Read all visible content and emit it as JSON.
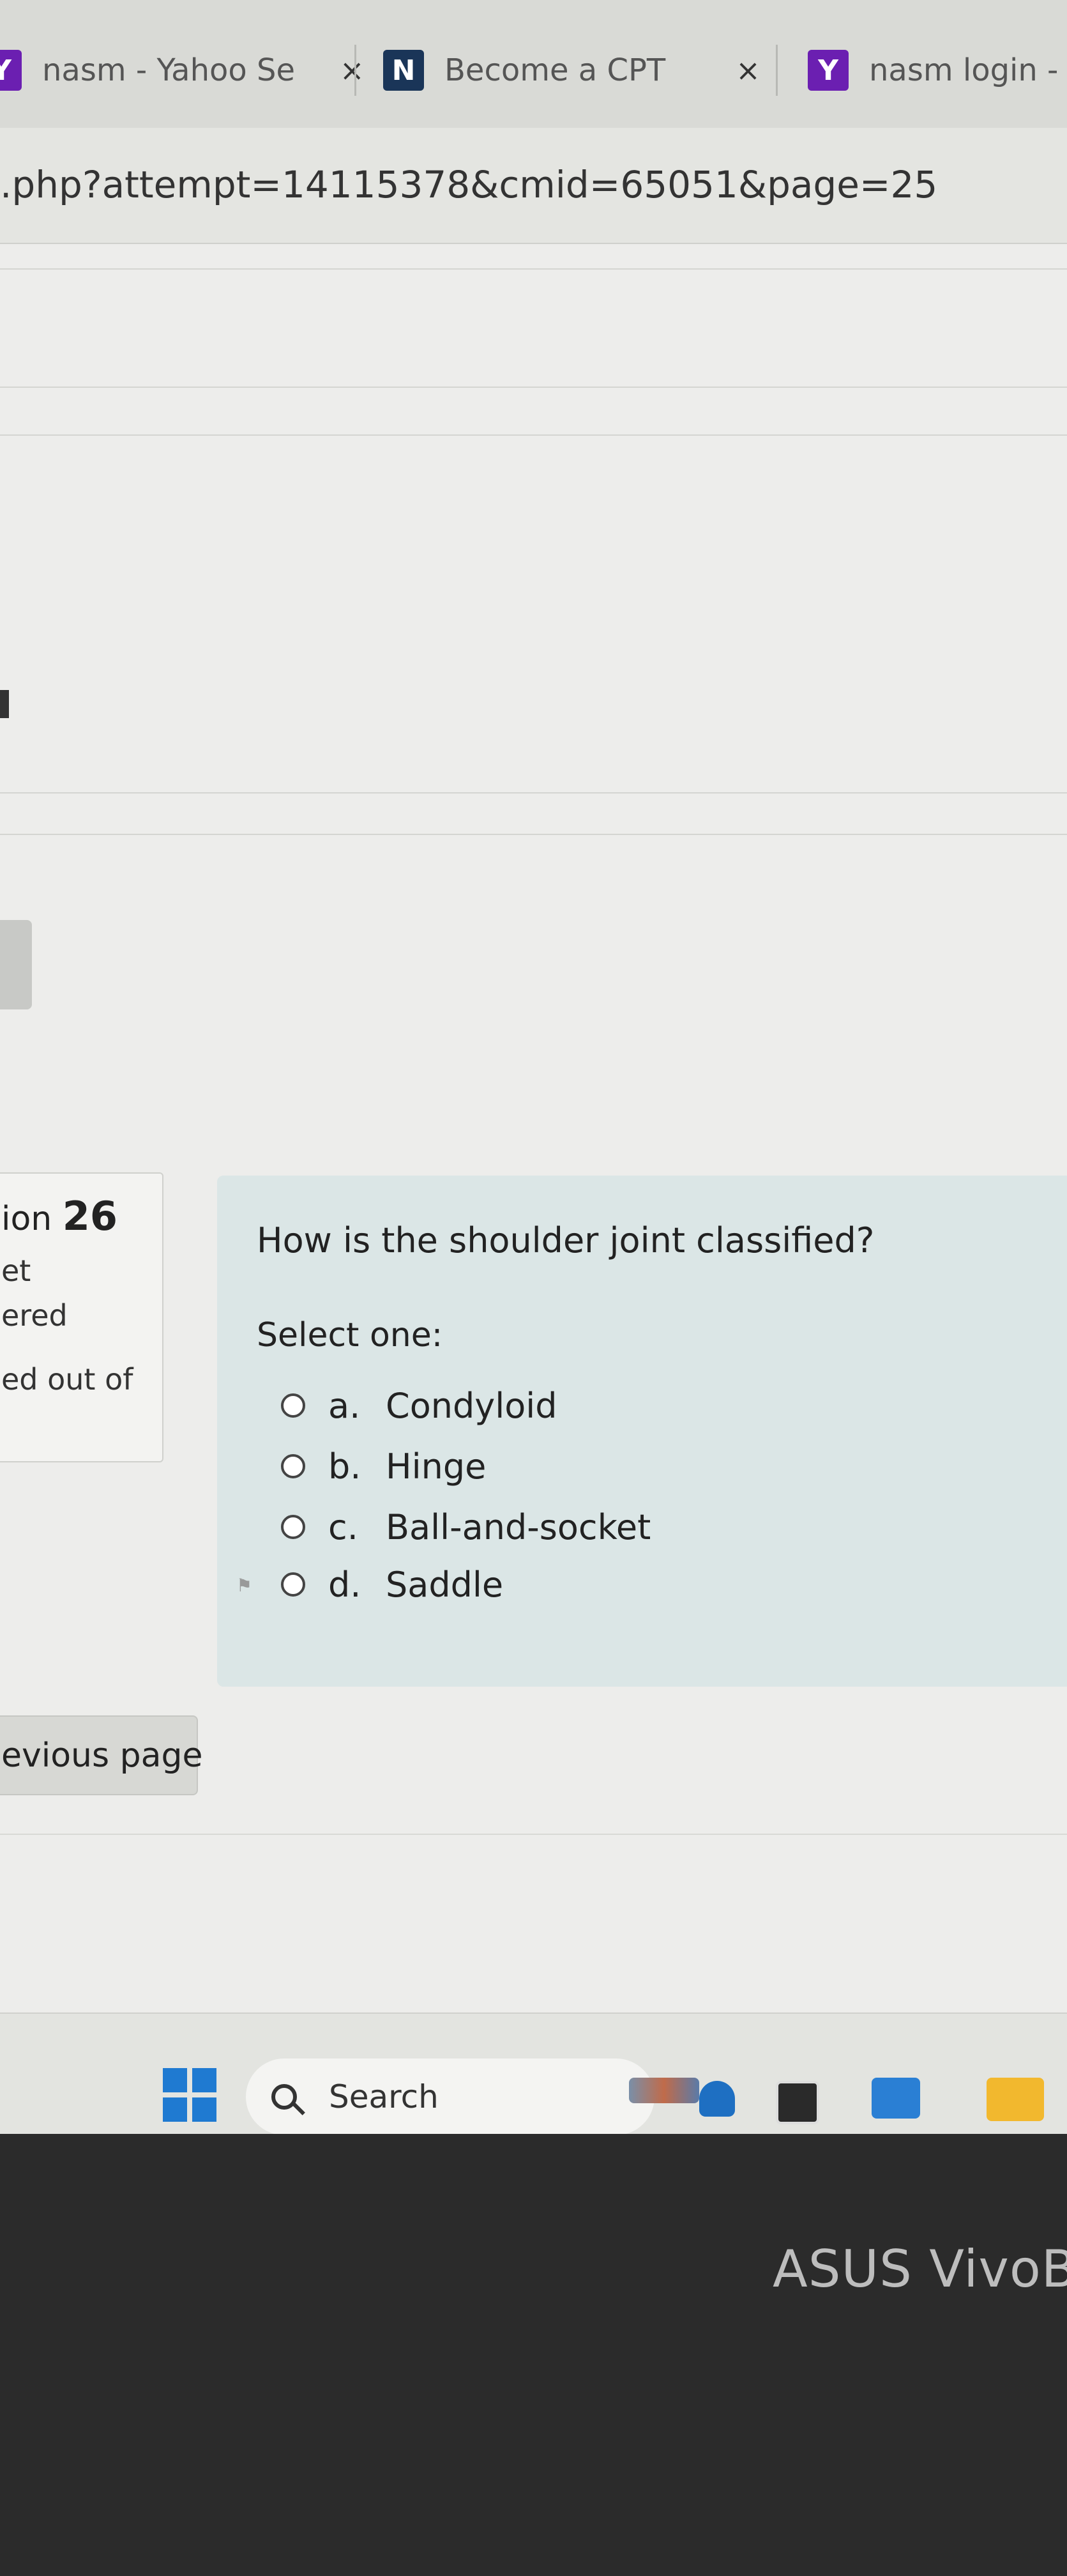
{
  "browser": {
    "tabs": [
      {
        "label": "nasm - Yahoo Se",
        "icon": "yahoo-icon",
        "icon_color": "#6b1fb1"
      },
      {
        "label": "Become a CPT",
        "icon": "nasm-n-icon",
        "icon_color": "#1a3558"
      },
      {
        "label": "nasm login -",
        "icon": "yahoo-icon",
        "icon_color": "#6b1fb1"
      }
    ],
    "close_glyph": "×",
    "address": ".php?attempt=14115378&cmid=65051&page=25"
  },
  "question_info": {
    "number_prefix": "ion",
    "number": "26",
    "status_line1": "et",
    "status_line2": "ered",
    "marks_line": "ed out of"
  },
  "question": {
    "text": "How is the shoulder joint classified?",
    "prompt": "Select one:",
    "options": [
      {
        "letter": "a.",
        "label": "Condyloid"
      },
      {
        "letter": "b.",
        "label": "Hinge"
      },
      {
        "letter": "c.",
        "label": "Ball-and-socket"
      },
      {
        "letter": "d.",
        "label": "Saddle"
      }
    ]
  },
  "navigation": {
    "previous_label": "evious page"
  },
  "taskbar": {
    "search_label": "Search"
  },
  "laptop": {
    "brand": "ASUS VivoBo"
  },
  "colors": {
    "question_bg": "#dbe6e6",
    "windows_blue": "#1f7ad1"
  }
}
